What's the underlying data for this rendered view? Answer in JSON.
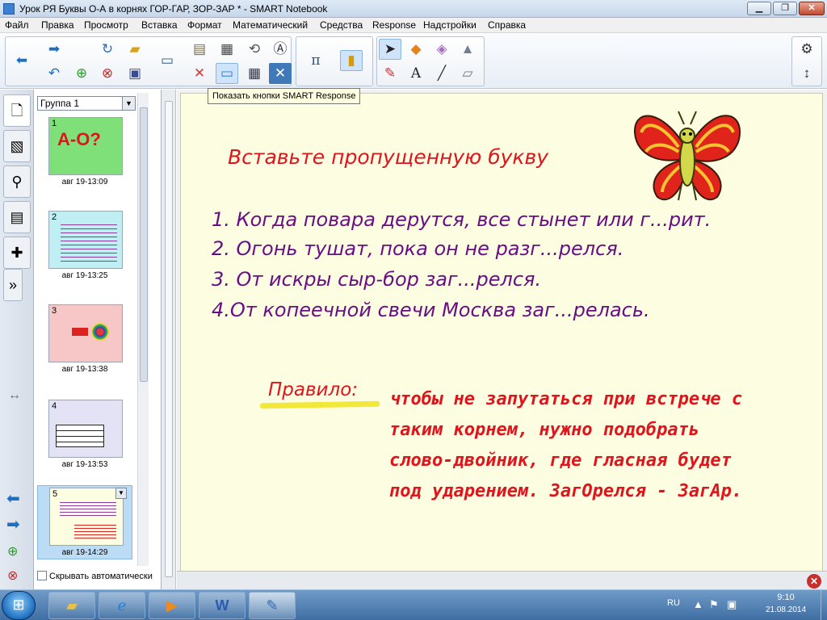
{
  "window": {
    "title": "Урок РЯ Буквы О-А в корнях ГОР-ГАР, ЗОР-ЗАР * - SMART Notebook",
    "minimize": "▁",
    "maximize": "❐",
    "close": "✕"
  },
  "menu": [
    "Файл",
    "Правка",
    "Просмотр",
    "Вставка",
    "Формат",
    "Математический",
    "Средства",
    "Response",
    "Надстройки",
    "Справка"
  ],
  "toolbar": {
    "tooltip": "Показать кнопки SMART Response",
    "icons": [
      "back-arrow-icon",
      "forward-arrow-icon",
      "undo-icon",
      "redo-icon",
      "add-page-icon",
      "delete-page-icon",
      "open-folder-icon",
      "save-icon",
      "document-camera-icon",
      "paste-icon",
      "screen-shade-icon",
      "delete-icon",
      "capture-icon",
      "response-buttons-icon",
      "table-icon",
      "spellcheck-icon",
      "fullscreen-icon",
      "math-pi-icon",
      "gallery-icon",
      "select-pointer-icon",
      "shapes-icon",
      "eraser-tool-icon",
      "fill-icon",
      "pens-icon",
      "text-icon",
      "line-icon",
      "eraser-icon",
      "settings-gear-icon",
      "move-toolbar-icon"
    ]
  },
  "sidebar": {
    "group_select": "Группа 1",
    "autohide_label": "Скрывать автоматически",
    "pages": [
      {
        "number": "1",
        "time": "авг 19-13:09",
        "thumb_text": "А-О?"
      },
      {
        "number": "2",
        "time": "авг 19-13:25",
        "thumb_text": ""
      },
      {
        "number": "3",
        "time": "авг 19-13:38",
        "thumb_text": ""
      },
      {
        "number": "4",
        "time": "авг 19-13:53",
        "thumb_text": ""
      },
      {
        "number": "5",
        "time": "авг 19-14:29",
        "thumb_text": ""
      }
    ]
  },
  "slide": {
    "heading": "Вставьте пропущенную букву",
    "tasks": [
      "1. Когда повара дерутся, все стынет или г...рит.",
      "2. Огонь тушат, пока он не разг...релся.",
      "3. От искры сыр-бор заг...релся.",
      "4.От копеечной свечи Москва заг...релась."
    ],
    "rule_label": "Правило:",
    "rule_lines": [
      "чтобы не запутаться при встрече с",
      "таким корнем, нужно подобрать",
      "слово-двойник, где гласная будет",
      "под ударением. ЗагОрелся - ЗагАр."
    ]
  },
  "taskbar": {
    "lang": "RU",
    "time": "9:10",
    "date": "21.08.2014"
  },
  "colors": {
    "slide_bg": "#fdfde1",
    "heading": "#e0141c",
    "task_text": "#6a0e86",
    "rule_text": "#e0141c"
  }
}
